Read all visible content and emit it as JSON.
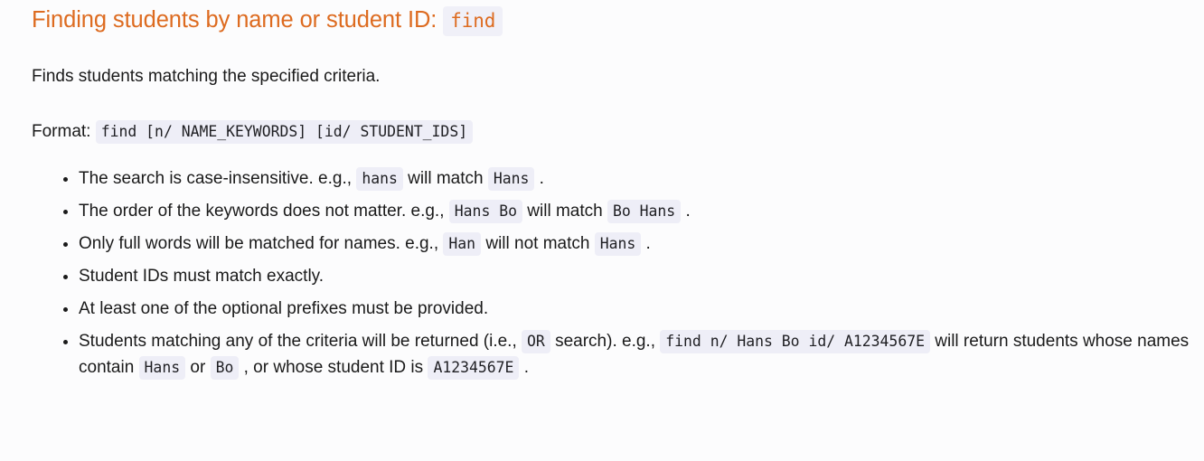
{
  "heading": {
    "text": "Finding students by name or student ID:",
    "command": "find"
  },
  "intro": {
    "text": "Finds students matching the specified criteria."
  },
  "format": {
    "label": "Format:",
    "syntax": "find [n/ NAME_KEYWORDS] [id/ STUDENT_IDS]"
  },
  "rules": [
    {
      "id": "case-insensitive",
      "parts": [
        {
          "type": "text",
          "value": "The search is case-insensitive. e.g., "
        },
        {
          "type": "code",
          "value": "hans"
        },
        {
          "type": "text",
          "value": " will match "
        },
        {
          "type": "code",
          "value": "Hans"
        },
        {
          "type": "text",
          "value": " ."
        }
      ]
    },
    {
      "id": "keyword-order",
      "parts": [
        {
          "type": "text",
          "value": "The order of the keywords does not matter. e.g., "
        },
        {
          "type": "code",
          "value": "Hans Bo"
        },
        {
          "type": "text",
          "value": " will match "
        },
        {
          "type": "code",
          "value": "Bo Hans"
        },
        {
          "type": "text",
          "value": " ."
        }
      ]
    },
    {
      "id": "full-words-only",
      "parts": [
        {
          "type": "text",
          "value": "Only full words will be matched for names. e.g., "
        },
        {
          "type": "code",
          "value": "Han"
        },
        {
          "type": "text",
          "value": " will not match "
        },
        {
          "type": "code",
          "value": "Hans"
        },
        {
          "type": "text",
          "value": " ."
        }
      ]
    },
    {
      "id": "exact-student-id",
      "parts": [
        {
          "type": "text",
          "value": "Student IDs must match exactly."
        }
      ]
    },
    {
      "id": "prefix-required",
      "parts": [
        {
          "type": "text",
          "value": "At least one of the optional prefixes must be provided."
        }
      ]
    },
    {
      "id": "or-search",
      "parts": [
        {
          "type": "text",
          "value": "Students matching any of the criteria will be returned (i.e., "
        },
        {
          "type": "code",
          "value": "OR"
        },
        {
          "type": "text",
          "value": " search). e.g., "
        },
        {
          "type": "code",
          "value": "find n/ Hans Bo id/ A1234567E",
          "wrap": true
        },
        {
          "type": "text",
          "value": " will return students whose names contain "
        },
        {
          "type": "code",
          "value": "Hans"
        },
        {
          "type": "text",
          "value": " or "
        },
        {
          "type": "code",
          "value": "Bo"
        },
        {
          "type": "text",
          "value": " , or whose student ID is "
        },
        {
          "type": "code",
          "value": "A1234567E"
        },
        {
          "type": "text",
          "value": " ."
        }
      ]
    }
  ],
  "colors": {
    "heading_orange": "#dd6b20",
    "code_background": "#eeeef7",
    "body_text": "#1a1a1a",
    "page_background": "#fcfcfd"
  }
}
